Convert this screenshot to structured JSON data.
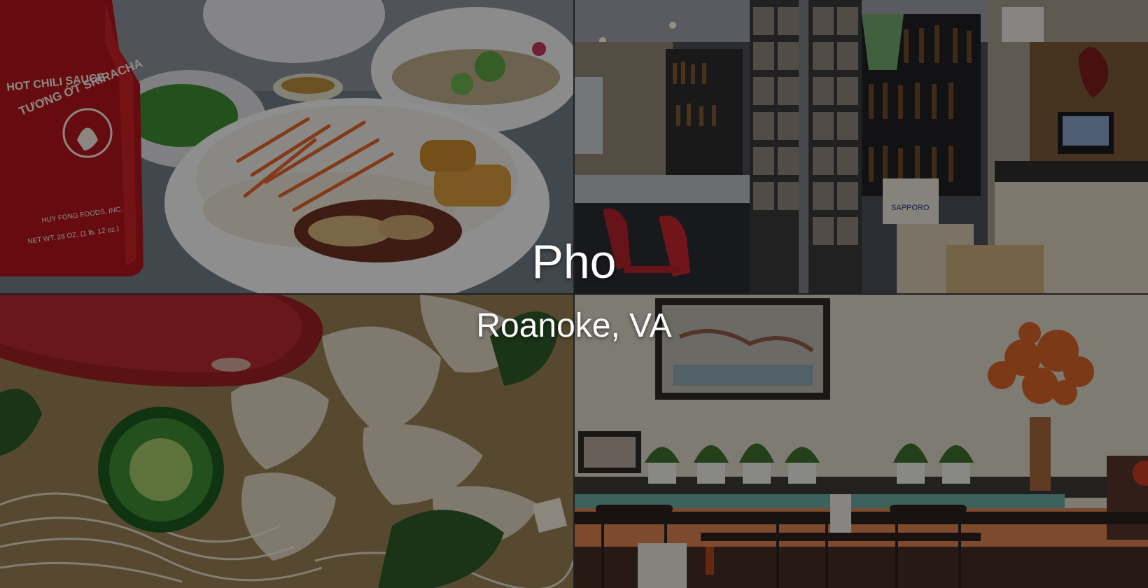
{
  "hero": {
    "title": "Pho",
    "subtitle": "Roanoke, VA"
  },
  "tiles": [
    {
      "id": "food-bowl-photo",
      "description_icon": "photo-icon"
    },
    {
      "id": "bar-interior-photo",
      "description_icon": "photo-icon"
    },
    {
      "id": "pho-closeup-photo",
      "description_icon": "photo-icon"
    },
    {
      "id": "dining-room-photo",
      "description_icon": "photo-icon"
    }
  ],
  "photo_text": {
    "sauce_brand": "HOT CHILI SAUCE",
    "sauce_name": "TƯƠNG ỚT SRIRACHA",
    "sauce_maker": "HUY FONG FOODS, INC.",
    "sauce_weight": "NET WT. 28 OZ. (1 lb. 12 oz.)",
    "beer_box": "SAPPORO"
  },
  "colors": {
    "overlay": "#000000",
    "text": "#ffffff"
  }
}
